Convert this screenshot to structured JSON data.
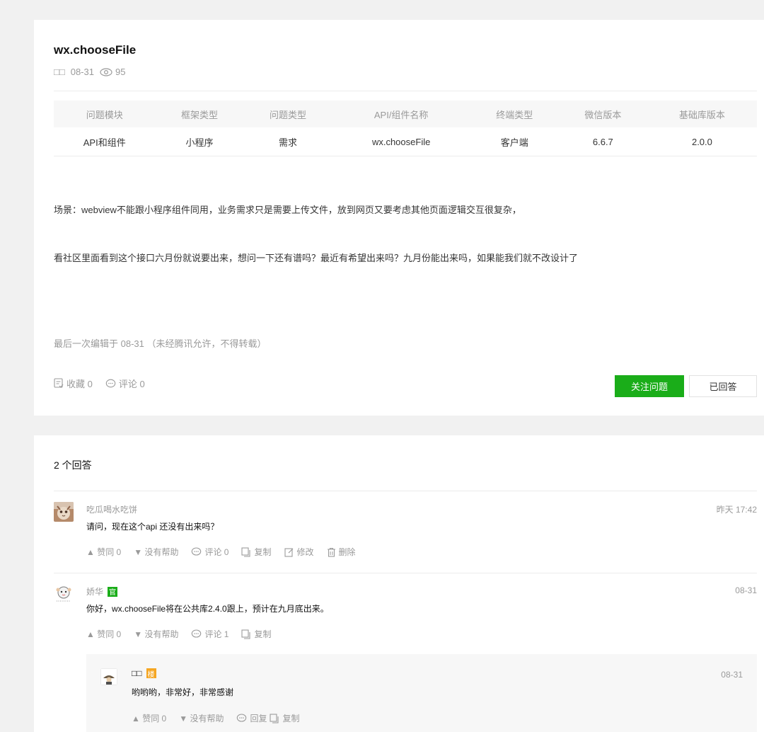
{
  "question": {
    "title": "wx.chooseFile",
    "author_glyph": "□□",
    "date": "08-31",
    "views": "95",
    "table": {
      "headers": [
        "问题模块",
        "框架类型",
        "问题类型",
        "API/组件名称",
        "终端类型",
        "微信版本",
        "基础库版本"
      ],
      "values": [
        "API和组件",
        "小程序",
        "需求",
        "wx.chooseFile",
        "客户端",
        "6.6.7",
        "2.0.0"
      ]
    },
    "paragraphs": [
      "场景：webview不能跟小程序组件同用，业务需求只是需要上传文件，放到网页又要考虑其他页面逻辑交互很复杂，",
      "看社区里面看到这个接口六月份就说要出来，想问一下还有谱吗？最近有希望出来吗？九月份能出来吗，如果能我们就不改设计了"
    ],
    "edit_note": "最后一次编辑于 08-31 （未经腾讯允许，不得转载）",
    "favorite_label": "收藏 0",
    "comment_label": "评论 0",
    "follow_button": "关注问题",
    "answered_button": "已回答"
  },
  "answers": {
    "count_label": "2 个回答",
    "items": [
      {
        "name": "吃瓜喝水吃饼",
        "time": "昨天 17:42",
        "body": "请问，现在这个api 还没有出来吗？",
        "upvote": "赞同 0",
        "unhelpful": "没有帮助",
        "comment": "评论 0",
        "copy": "复制",
        "edit": "修改",
        "delete": "删除"
      },
      {
        "name": "娇华",
        "badge": "官",
        "time": "08-31",
        "body": "你好，wx.chooseFile将在公共库2.4.0跟上，预计在九月底出来。",
        "upvote": "赞同 0",
        "unhelpful": "没有帮助",
        "comment": "评论 1",
        "copy": "复制"
      }
    ],
    "reply": {
      "name": "□□",
      "badge": "楼",
      "time": "08-31",
      "body": "哟哟哟，非常好，非常感谢",
      "upvote": "赞同 0",
      "unhelpful": "没有帮助",
      "reply": "回复",
      "copy": "复制"
    }
  },
  "colors": {
    "green": "#1aad19",
    "orange": "#f5a623",
    "muted": "#9a9a9a"
  }
}
